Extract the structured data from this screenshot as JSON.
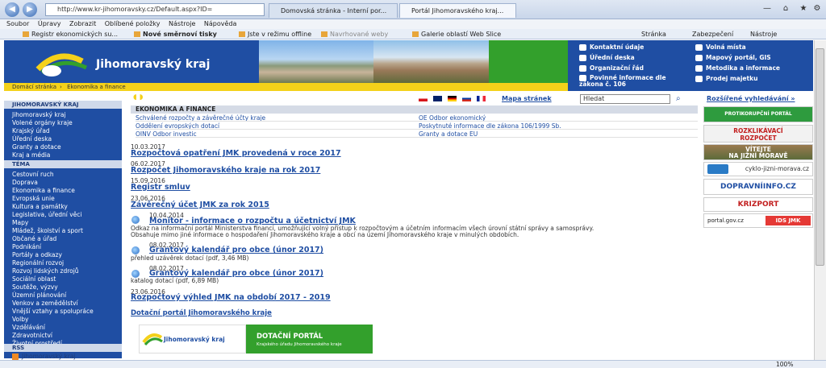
{
  "browser": {
    "address": "http://www.kr-jihomoravsky.cz/Default.aspx?ID=",
    "tabs": [
      "Domovská stránka - Interní por...",
      "Portál Jihomoravského kraj..."
    ],
    "menu": [
      "Soubor",
      "Úpravy",
      "Zobrazit",
      "Oblíbené položky",
      "Nástroje",
      "Nápověda"
    ],
    "favorites": [
      "Registr ekonomických su...",
      "Nové směrnoví tisky",
      "Jste v režimu offline",
      "Navrhované weby",
      "Galerie oblastí Web Slice"
    ],
    "commands": [
      "Stránka",
      "Zabezpečení",
      "Nástroje"
    ],
    "zoom": "100%"
  },
  "site": {
    "name": "Jihomoravský kraj",
    "breadcrumb": [
      "Domácí stránka",
      "Ekonomika a finance"
    ],
    "toplinks": [
      "Kontaktní údaje",
      "Úřední deska",
      "Organizační řád",
      "Povinné informace dle zákona č. 106",
      "Volná místa",
      "Mapový portál, GIS",
      "Metodika a informace",
      "Prodej majetku"
    ]
  },
  "leftnav": {
    "head1": "JIHOMORAVSKÝ KRAJ",
    "group1": [
      "Jihomoravský kraj",
      "Volené orgány kraje",
      "Krajský úřad",
      "Úřední deska",
      "Granty a dotace",
      "Kraj a média"
    ],
    "head2": "TÉMA",
    "group2": [
      "Cestovní ruch",
      "Doprava",
      "Ekonomika a finance",
      "Evropská unie",
      "Kultura a památky",
      "Legislativa, úřední věci",
      "Mapy",
      "Mládež, školství a sport",
      "Občané a úřad",
      "Podnikání",
      "Portály a odkazy",
      "Regionální rozvoj",
      "Rozvoj lidských zdrojů",
      "Sociální oblast",
      "Soutěže, výzvy",
      "Územní plánování",
      "Venkov a zemědělství",
      "Vnější vztahy a spolupráce",
      "Volby",
      "Vzdělávání",
      "Zdravotnictví",
      "Životní prostředí"
    ],
    "rss_head": "RSS",
    "rss_item": "Jihomoravský kraj"
  },
  "main": {
    "mapa": "Mapa stránek",
    "search_value": "Hledat",
    "advanced": "Rozšířené vyhledávání »",
    "section": "EKONOMIKA A FINANCE",
    "links": [
      "Schválené rozpočty a závěrečné účty kraje",
      "Oddělení evropských dotací",
      "OINV Odbor investic",
      "OE Odbor ekonomický",
      "Poskytnuté informace dle zákona 106/1999 Sb.",
      "Granty a dotace EU"
    ],
    "news": [
      {
        "date": "10.03.2017",
        "title": "Rozpočtová opatření JMK provedená v roce 2017"
      },
      {
        "date": "06.02.2017",
        "title": "Rozpočet Jihomoravského kraje na rok 2017"
      },
      {
        "date": "15.09.2016",
        "title": "Registr smluv"
      },
      {
        "date": "23.06.2016",
        "title": "Závěrečný účet JMK za rok 2015"
      },
      {
        "date": "10.04.2014",
        "title": "Monitor - informace o rozpočtu a účetnictví JMK",
        "desc1": "Odkaz na informační portál Ministerstva financí, umožňující volný přístup k rozpočtovým a účetním informacím všech úrovní státní správy a samosprávy.",
        "desc2": "Obsahuje mimo jiné informace o hospodaření Jihomoravského kraje a obcí na území Jihomoravského kraje v minulých obdobích."
      },
      {
        "date": "08.02.2017",
        "title": "Grantový kalendář pro obce (únor 2017)",
        "desc1": "přehled uzávěrek dotací (pdf, 3,46 MB)"
      },
      {
        "date": "08.02.2017",
        "title": "Grantový kalendář pro obce (únor 2017)",
        "desc1": "katalog dotací (pdf, 6,89 MB)"
      },
      {
        "date": "23.06.2016",
        "title": "Rozpočtový výhled JMK na období 2017 - 2019"
      }
    ],
    "portal_link": "Dotační portál Jihomoravského kraje",
    "banner_left": "Jihomoravský kraj",
    "banner_right_title": "DOTAČNÍ PORTÁL",
    "banner_right_sub": "Krajského úřadu Jihomoravského kraje"
  },
  "right": {
    "b1": "PROTIKORUPČNÍ PORTÁL",
    "b2a": "ROZKLIKÁVACÍ",
    "b2b": "ROZPOČET",
    "b3a": "VÍTEJTE",
    "b3b": "NA JIŽNÍ MORAVĚ",
    "b4": "cyklo-jizni-morava.cz",
    "b5": "DOPRAVNÍINFO.CZ",
    "b6": "KRIZPORT",
    "b7a": "portal.gov.cz",
    "b7b": "IDS JMK"
  },
  "colors": {
    "brand": "#1f4ea3",
    "yellow": "#f4d11a",
    "green": "#33a02c"
  }
}
